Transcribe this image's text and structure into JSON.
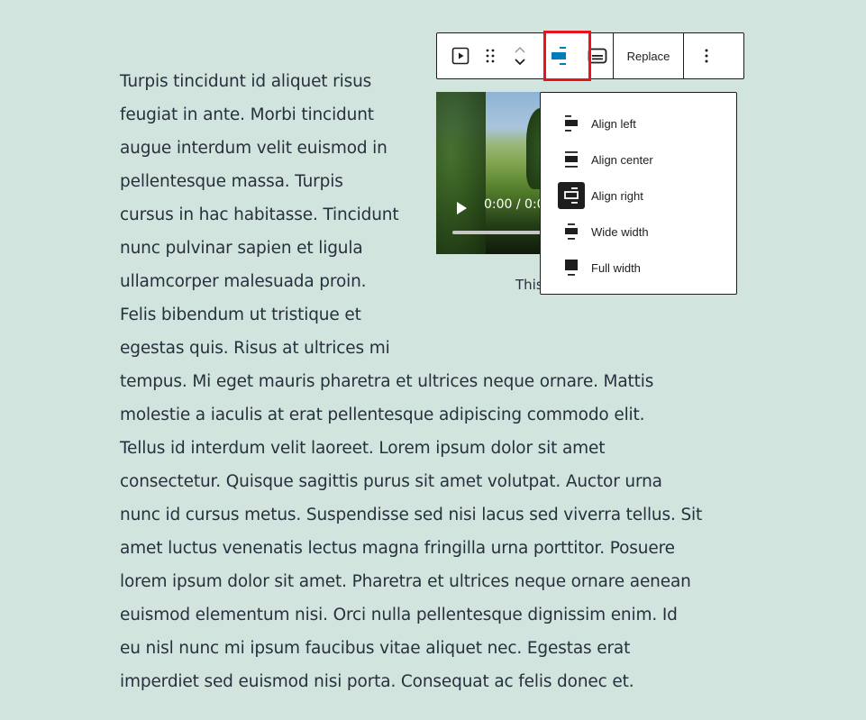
{
  "paragraph": {
    "lines": [
      "Turpis tincidunt id aliquet risus",
      "feugiat in ante. Morbi tincidunt",
      "augue interdum velit euismod in",
      "pellentesque massa. Turpis",
      "cursus in hac habitasse. Tincidunt",
      "nunc pulvinar sapien et ligula",
      "ullamcorper malesuada proin.",
      "Felis bibendum ut tristique et",
      "egestas quis. Risus at ultrices mi",
      "tempus. Mi eget mauris pharetra et ultrices neque ornare. Mattis",
      "molestie a iaculis at erat pellentesque adipiscing commodo elit.",
      "Tellus id interdum velit laoreet. Lorem ipsum dolor sit amet",
      "consectetur. Quisque sagittis purus sit amet volutpat. Auctor urna",
      "nunc id cursus metus. Suspendisse sed nisi lacus sed viverra tellus. Sit",
      "amet luctus venenatis lectus magna fringilla urna porttitor. Posuere",
      "lorem ipsum dolor sit amet. Pharetra et ultrices neque ornare aenean",
      "euismod elementum nisi. Orci nulla pellentesque dignissim enim. Id",
      "eu nisl nunc mi ipsum faucibus vitae aliquet nec. Egestas erat",
      "imperdiet sed euismod nisi porta. Consequat ac felis donec et."
    ]
  },
  "toolbar": {
    "block_type_icon": "video-block-icon",
    "drag_icon": "drag-handle-icon",
    "move_up_icon": "chevron-up-icon",
    "move_down_icon": "chevron-down-icon",
    "align_icon": "align-right-icon",
    "caption_icon": "caption-icon",
    "replace_label": "Replace",
    "more_icon": "more-vertical-icon",
    "accent_color": "#007cba",
    "highlight_color": "#e8141b"
  },
  "video": {
    "time": "0:00 / 0:0",
    "caption": "This"
  },
  "align_menu": {
    "items": [
      {
        "label": "Align left",
        "icon": "align-left-icon",
        "active": false
      },
      {
        "label": "Align center",
        "icon": "align-center-icon",
        "active": false
      },
      {
        "label": "Align right",
        "icon": "align-right-icon",
        "active": true
      },
      {
        "label": "Wide width",
        "icon": "wide-width-icon",
        "active": false
      },
      {
        "label": "Full width",
        "icon": "full-width-icon",
        "active": false
      }
    ]
  }
}
